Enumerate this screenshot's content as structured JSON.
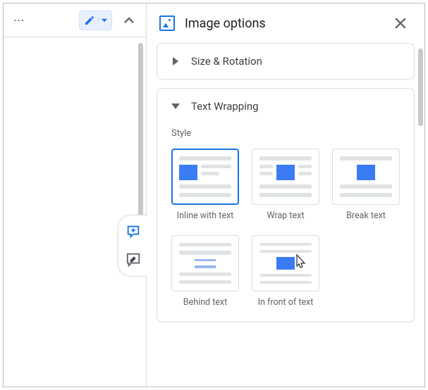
{
  "panel": {
    "title": "Image options"
  },
  "sections": {
    "size_rotation": {
      "title": "Size & Rotation"
    },
    "text_wrapping": {
      "title": "Text Wrapping",
      "style_label": "Style",
      "options": [
        {
          "label": "Inline with text"
        },
        {
          "label": "Wrap text"
        },
        {
          "label": "Break text"
        },
        {
          "label": "Behind text"
        },
        {
          "label": "In front of text"
        }
      ]
    }
  }
}
